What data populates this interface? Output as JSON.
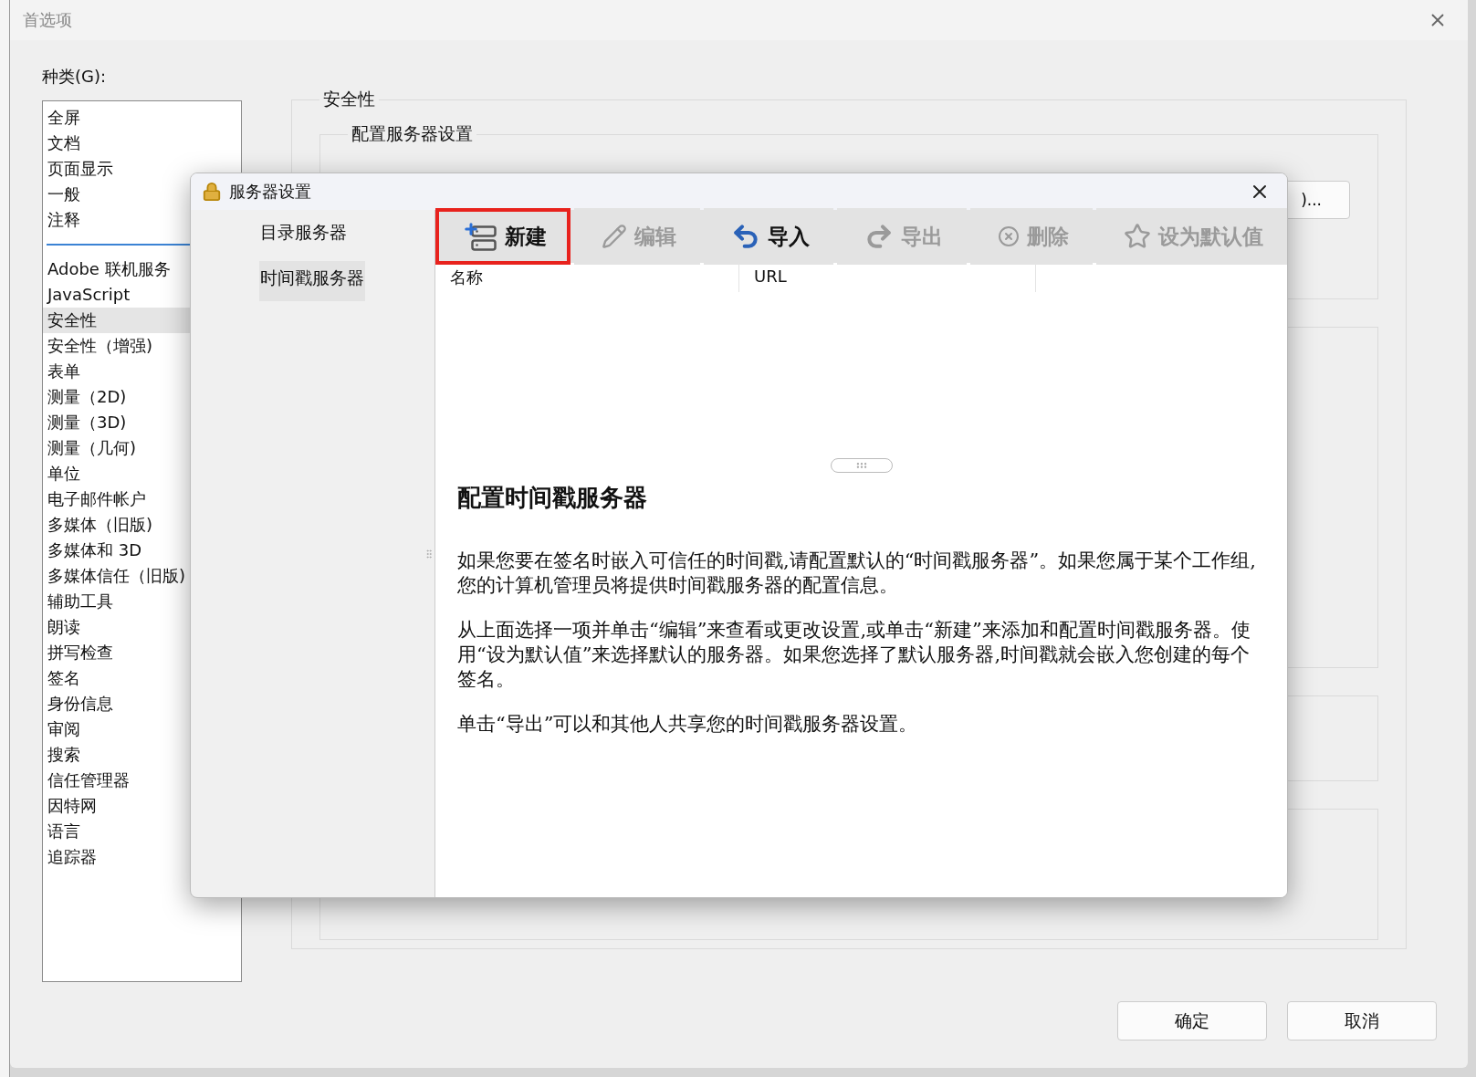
{
  "window": {
    "title": "首选项"
  },
  "category_label": "种类(G):",
  "category_groups": [
    [
      {
        "label": "全屏",
        "selected": false
      },
      {
        "label": "文档",
        "selected": false
      },
      {
        "label": "页面显示",
        "selected": false
      },
      {
        "label": "一般",
        "selected": false
      },
      {
        "label": "注释",
        "selected": false
      }
    ],
    [
      {
        "label": "Adobe 联机服务",
        "selected": false
      },
      {
        "label": "JavaScript",
        "selected": false
      },
      {
        "label": "安全性",
        "selected": true
      },
      {
        "label": "安全性（增强)",
        "selected": false
      },
      {
        "label": "表单",
        "selected": false
      },
      {
        "label": "测量（2D)",
        "selected": false
      },
      {
        "label": "测量（3D)",
        "selected": false
      },
      {
        "label": "测量（几何)",
        "selected": false
      },
      {
        "label": "单位",
        "selected": false
      },
      {
        "label": "电子邮件帐户",
        "selected": false
      },
      {
        "label": "多媒体（旧版)",
        "selected": false
      },
      {
        "label": "多媒体和 3D",
        "selected": false
      },
      {
        "label": "多媒体信任（旧版)",
        "selected": false
      },
      {
        "label": "辅助工具",
        "selected": false
      },
      {
        "label": "朗读",
        "selected": false
      },
      {
        "label": "拼写检查",
        "selected": false
      },
      {
        "label": "签名",
        "selected": false
      },
      {
        "label": "身份信息",
        "selected": false
      },
      {
        "label": "审阅",
        "selected": false
      },
      {
        "label": "搜索",
        "selected": false
      },
      {
        "label": "信任管理器",
        "selected": false
      },
      {
        "label": "因特网",
        "selected": false
      },
      {
        "label": "语言",
        "selected": false
      },
      {
        "label": "追踪器",
        "selected": false
      }
    ]
  ],
  "security_group": {
    "title": "安全性",
    "server_group": {
      "title": "配置服务器设置",
      "button_fragment": ")..."
    }
  },
  "buttons": [
    "确定",
    "取消"
  ],
  "dialog": {
    "title": "服务器设置",
    "nav": [
      {
        "label": "目录服务器",
        "selected": false
      },
      {
        "label": "时间戳服务器",
        "selected": true
      }
    ],
    "toolbar": [
      {
        "label": "新建",
        "kind": "new",
        "disabled": false,
        "highlighted": true
      },
      {
        "label": "编辑",
        "kind": "edit",
        "disabled": true,
        "highlighted": false
      },
      {
        "label": "导入",
        "kind": "import",
        "disabled": false,
        "highlighted": false
      },
      {
        "label": "导出",
        "kind": "export",
        "disabled": true,
        "highlighted": false
      },
      {
        "label": "删除",
        "kind": "delete",
        "disabled": true,
        "highlighted": false
      },
      {
        "label": "设为默认值",
        "kind": "default",
        "disabled": true,
        "highlighted": false
      }
    ],
    "columns": [
      "名称",
      "URL"
    ],
    "help_title": "配置时间戳服务器",
    "help_paragraphs": [
      "如果您要在签名时嵌入可信任的时间戳,请配置默认的“时间戳服务器”。如果您属于某个工作组,您的计算机管理员将提供时间戳服务器的配置信息。",
      "从上面选择一项并单击“编辑”来查看或更改设置,或单击“新建”来添加和配置时间戳服务器。使用“设为默认值”来选择默认的服务器。如果您选择了默认服务器,时间戳就会嵌入您创建的每个签名。",
      "单击“导出”可以和其他人共享您的时间戳服务器设置。"
    ]
  }
}
